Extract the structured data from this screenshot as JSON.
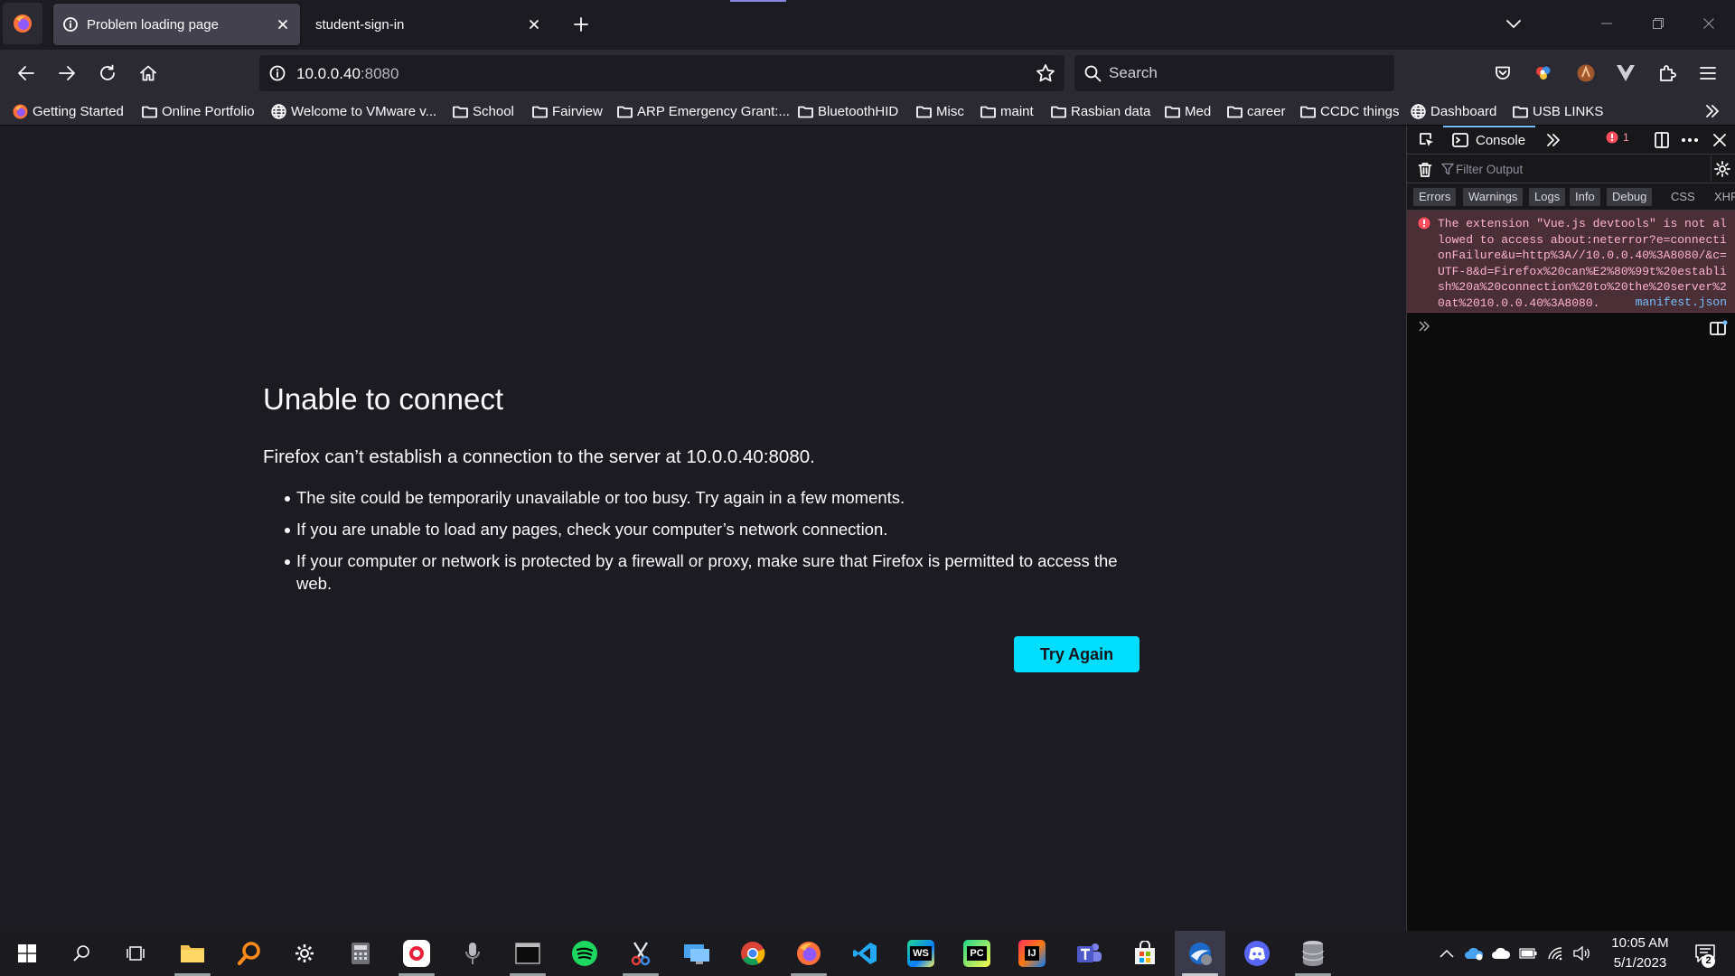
{
  "tabs": [
    {
      "title": "Problem loading page"
    },
    {
      "title": "student-sign-in"
    }
  ],
  "url": {
    "host": "10.0.0.40",
    "port": ":8080"
  },
  "search": {
    "placeholder": "Search"
  },
  "bookmarks": [
    {
      "label": "Getting Started",
      "icon": "firefox-icon"
    },
    {
      "label": "Online Portfolio",
      "icon": "folder-icon"
    },
    {
      "label": "Welcome to VMware v...",
      "icon": "globe-icon"
    },
    {
      "label": "School",
      "icon": "folder-icon"
    },
    {
      "label": "Fairview",
      "icon": "folder-icon"
    },
    {
      "label": "ARP Emergency Grant:...",
      "icon": "folder-icon"
    },
    {
      "label": "BluetoothHID",
      "icon": "folder-icon"
    },
    {
      "label": "Misc",
      "icon": "folder-icon"
    },
    {
      "label": "maint",
      "icon": "folder-icon"
    },
    {
      "label": "Rasbian data",
      "icon": "folder-icon"
    },
    {
      "label": "Med",
      "icon": "folder-icon"
    },
    {
      "label": "career",
      "icon": "folder-icon"
    },
    {
      "label": "CCDC things",
      "icon": "folder-icon"
    },
    {
      "label": "Dashboard",
      "icon": "globe-icon"
    },
    {
      "label": "USB LINKS",
      "icon": "folder-icon"
    }
  ],
  "error_page": {
    "title": "Unable to connect",
    "description": "Firefox can’t establish a connection to the server at 10.0.0.40:8080.",
    "items": [
      "The site could be temporarily unavailable or too busy. Try again in a few moments.",
      "If you are unable to load any pages, check your computer’s network connection.",
      "If your computer or network is protected by a firewall or proxy, make sure that Firefox is permitted to access the web."
    ],
    "button": "Try Again"
  },
  "devtools": {
    "tab": "Console",
    "error_count": "1",
    "filter_placeholder": "Filter Output",
    "levels": [
      "Errors",
      "Warnings",
      "Logs",
      "Info",
      "Debug"
    ],
    "extra_filters": [
      "CSS",
      "XHR"
    ],
    "message": "The extension \"Vue.js devtools\" is not allowed to access about:neterror?e=connectionFailure&u=http%3A//10.0.0.40%3A8080/&c=UTF-8&d=Firefox%20can%E2%80%99t%20establish%20a%20connection%20to%20the%20server%20at%2010.0.0.40%3A8080.",
    "message_source": "manifest.json"
  },
  "taskbar": {
    "time": "10:05 AM",
    "date": "5/1/2023",
    "notification_count": "2"
  },
  "colors": {
    "accent": "#00ddff",
    "page_bg": "#1c1b22",
    "toolbar_bg": "#2b2a33",
    "error_bg": "#4b2f36"
  }
}
